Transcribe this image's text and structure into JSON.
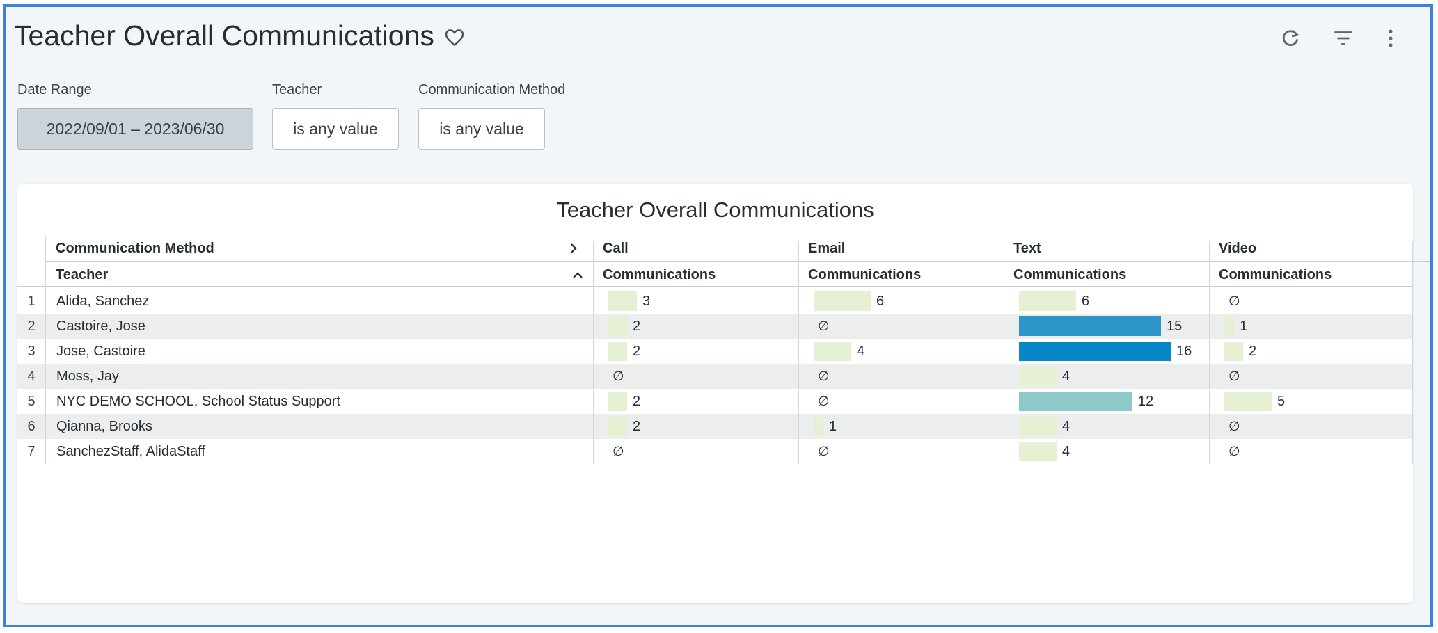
{
  "header": {
    "title": "Teacher Overall Communications"
  },
  "icons": {
    "favorite": "heart-outline-icon",
    "reload": "refresh-icon",
    "filter": "filter-icon",
    "more": "more-vert-icon"
  },
  "filters": [
    {
      "label": "Date Range",
      "value": "2022/09/01 – 2023/06/30"
    },
    {
      "label": "Teacher",
      "value": "is any value"
    },
    {
      "label": "Communication Method",
      "value": "is any value"
    }
  ],
  "table": {
    "title": "Teacher Overall Communications",
    "pivot_header": "Communication Method",
    "row_header": "Teacher",
    "measure": "Communications",
    "null_symbol": "∅",
    "methods": [
      "Call",
      "Email",
      "Text",
      "Video"
    ],
    "rows": [
      {
        "index": "1",
        "teacher": "Alida, Sanchez",
        "Call": 3,
        "Email": 6,
        "Text": 6,
        "Video": null
      },
      {
        "index": "2",
        "teacher": "Castoire, Jose",
        "Call": 2,
        "Email": null,
        "Text": 15,
        "Video": 1
      },
      {
        "index": "3",
        "teacher": "Jose, Castoire",
        "Call": 2,
        "Email": 4,
        "Text": 16,
        "Video": 2
      },
      {
        "index": "4",
        "teacher": "Moss, Jay",
        "Call": null,
        "Email": null,
        "Text": 4,
        "Video": null
      },
      {
        "index": "5",
        "teacher": "NYC DEMO SCHOOL, School Status Support",
        "Call": 2,
        "Email": null,
        "Text": 12,
        "Video": 5
      },
      {
        "index": "6",
        "teacher": "Qianna, Brooks",
        "Call": 2,
        "Email": 1,
        "Text": 4,
        "Video": null
      },
      {
        "index": "7",
        "teacher": "SanchezStaff, AlidaStaff",
        "Call": null,
        "Email": null,
        "Text": 4,
        "Video": null
      }
    ]
  },
  "colors": {
    "frame_border": "#3b82e0",
    "bar_low": "#e6f0d3",
    "bar_mid": "#8ecac9",
    "bar_high": "#2e95c8",
    "bar_max": "#0787c8"
  }
}
